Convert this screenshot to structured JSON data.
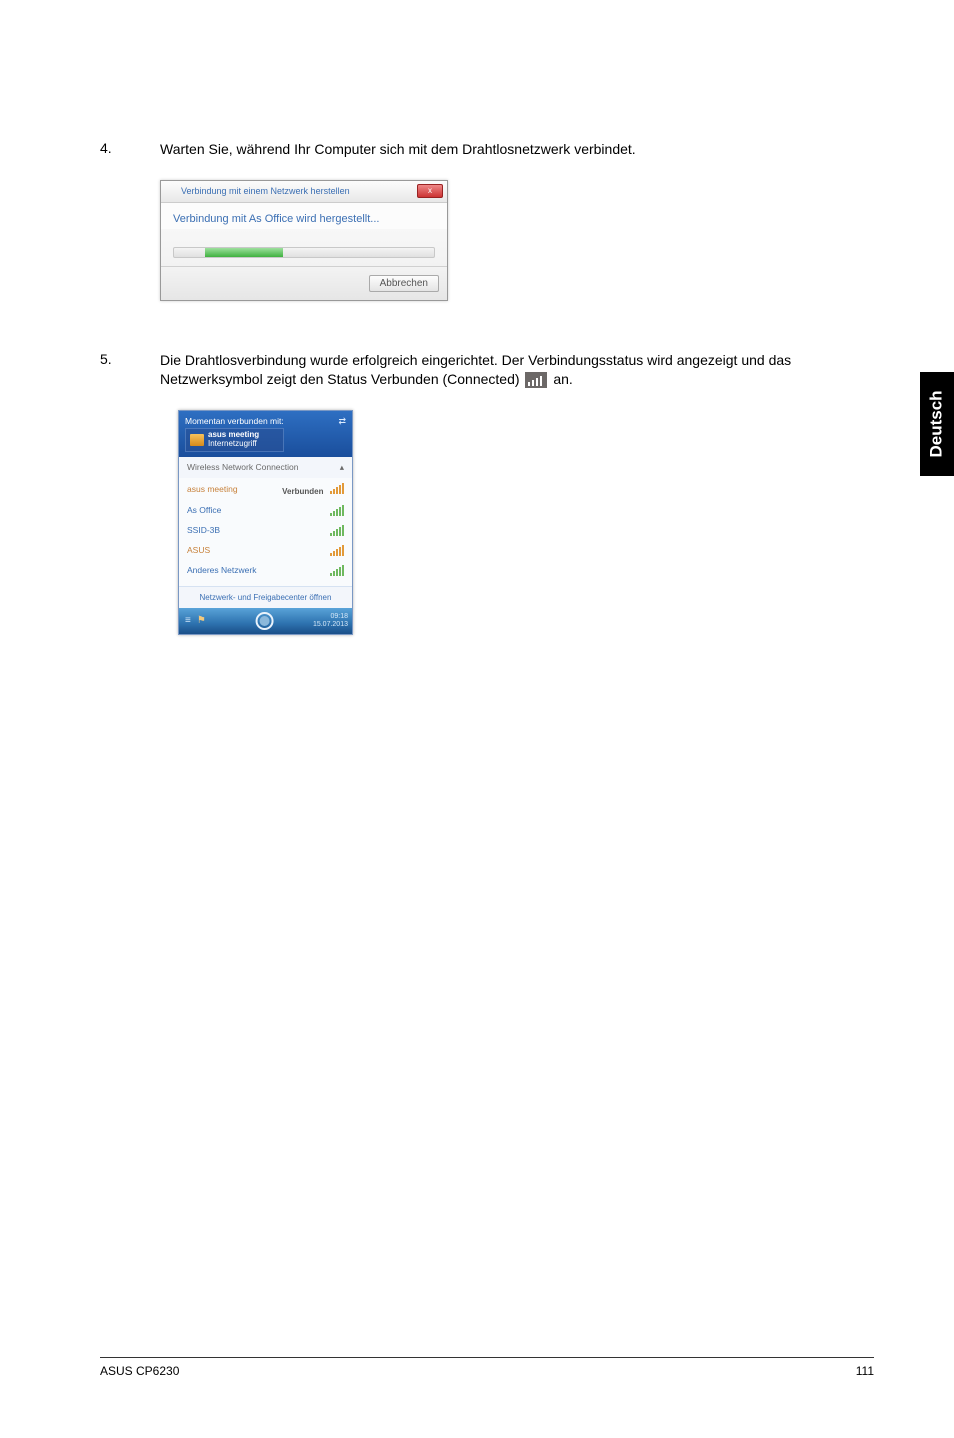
{
  "steps": {
    "s4": {
      "number": "4.",
      "text": "Warten Sie, während Ihr Computer sich mit dem Drahtlosnetzwerk verbindet."
    },
    "s5": {
      "number": "5.",
      "text_part1": "Die Drahtlosverbindung wurde erfolgreich eingerichtet. Der Verbindungsstatus wird angezeigt und das Netzwerksymbol zeigt den Status Verbunden (Connected) ",
      "text_part2": " an."
    }
  },
  "dialog1": {
    "title": "Verbindung mit einem Netzwerk herstellen",
    "close_x": "x",
    "body": "Verbindung mit As Office wird hergestellt...",
    "cancel": "Abbrechen"
  },
  "popup2": {
    "header_top": "Momentan verbunden mit:",
    "header_net_name": "asus meeting",
    "header_net_sub": "Internetzugriff",
    "header_right": "⇄",
    "section": "Wireless Network Connection",
    "section_arrow": "▴",
    "items": [
      {
        "name": "asus meeting",
        "status": "Verbunden",
        "sig_class": "orange"
      },
      {
        "name": "As Office",
        "status": "",
        "sig_class": ""
      },
      {
        "name": "SSID-3B",
        "status": "",
        "sig_class": ""
      },
      {
        "name": "ASUS",
        "status": "",
        "sig_class": "orange red"
      },
      {
        "name": "Anderes Netzwerk",
        "status": "",
        "sig_class": ""
      }
    ],
    "link": "Netzwerk- und Freigabecenter öffnen",
    "taskbar_time": "09:18",
    "taskbar_date": "15.07.2013"
  },
  "sidetab": "Deutsch",
  "footer": {
    "left": "ASUS CP6230",
    "right": "111"
  }
}
